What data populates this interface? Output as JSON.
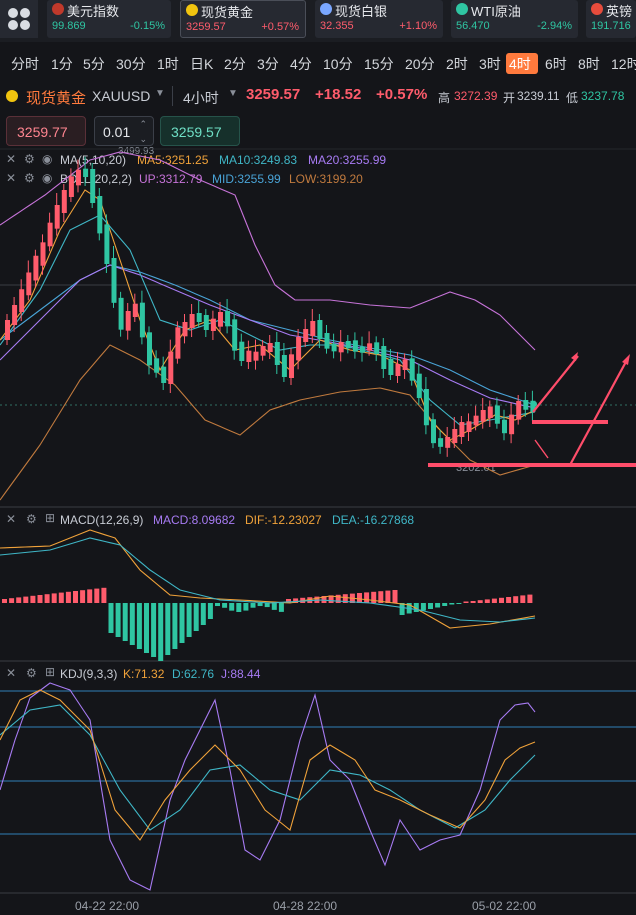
{
  "ticker": [
    {
      "name": "美元指数",
      "price": "99.869",
      "change": "-0.15%",
      "dir": "down",
      "flag_color": "#c0392b",
      "icon": "us-flag-icon"
    },
    {
      "name": "现货黄金",
      "price": "3259.57",
      "change": "+0.57%",
      "dir": "up",
      "flag_color": "#f1c40f",
      "icon": "gold-icon"
    },
    {
      "name": "现货白银",
      "price": "32.355",
      "change": "+1.10%",
      "dir": "up",
      "flag_color": "#7aa7ff",
      "icon": "silver-icon"
    },
    {
      "name": "WTI原油",
      "price": "56.470",
      "change": "-2.94%",
      "dir": "down",
      "flag_color": "#2fc5a2",
      "icon": "oil-icon"
    },
    {
      "name": "英镑",
      "price": "191.716",
      "change": "",
      "dir": "down",
      "flag_color": "#e74c3c",
      "icon": "uk-flag-icon"
    }
  ],
  "timeframes": [
    "分时",
    "1分",
    "5分",
    "30分",
    "1时",
    "日K",
    "2分",
    "3分",
    "4分",
    "10分",
    "15分",
    "20分",
    "2时",
    "3时",
    "4时",
    "6时",
    "8时",
    "12时"
  ],
  "active_timeframe": "4时",
  "symbol": {
    "name": "现货黄金",
    "code": "XAUUSD",
    "period": "4小时",
    "price": "3259.57",
    "change": "+18.52",
    "change_pct": "+0.57%",
    "high_label": "高",
    "high": "3272.39",
    "open_label": "开",
    "open": "3239.11",
    "low_label": "低",
    "low": "3237.78"
  },
  "order": {
    "sell_price": "3259.77",
    "lots": "0.01",
    "buy_price": "3259.57"
  },
  "main_indicators": {
    "ma": {
      "label": "MA(5,10,20)",
      "ma5": "MA5:3251.25",
      "ma10": "MA10:3249.83",
      "ma20": "MA20:3255.99"
    },
    "boll": {
      "label": "BOLL(20,2,2)",
      "up": "UP:3312.79",
      "mid": "MID:3255.99",
      "low": "LOW:3199.20"
    },
    "high_mark": "3499.93",
    "low_mark": "3202.01"
  },
  "macd": {
    "label": "MACD(12,26,9)",
    "macd": "MACD:8.09682",
    "dif": "DIF:-12.23027",
    "dea": "DEA:-16.27868"
  },
  "kdj": {
    "label": "KDJ(9,3,3)",
    "k": "K:71.32",
    "d": "D:62.76",
    "j": "J:88.44"
  },
  "x_axis": [
    "04-22 22:00",
    "04-28 22:00",
    "05-02 22:00"
  ],
  "colors": {
    "up": "#ff5c6c",
    "down": "#2fc5a2",
    "ma5": "#f0a23a",
    "ma10": "#3fb6c6",
    "ma20": "#a77bf3",
    "boll_up": "#c673d8",
    "boll_mid": "#49a3d6",
    "boll_low": "#c07a3e",
    "accent": "#ff7a3d",
    "annot": "#ff4d6a"
  },
  "chart_data": [
    {
      "type": "line",
      "title": "KDJ(9,3,3)",
      "x": [
        "04-22 22:00",
        "04-28 22:00",
        "05-02 22:00"
      ],
      "series": [
        {
          "name": "K",
          "values": [
            43,
            64,
            54
          ]
        },
        {
          "name": "D",
          "values": [
            53,
            61,
            48
          ]
        },
        {
          "name": "J",
          "values": [
            22,
            74,
            74
          ]
        }
      ]
    }
  ]
}
